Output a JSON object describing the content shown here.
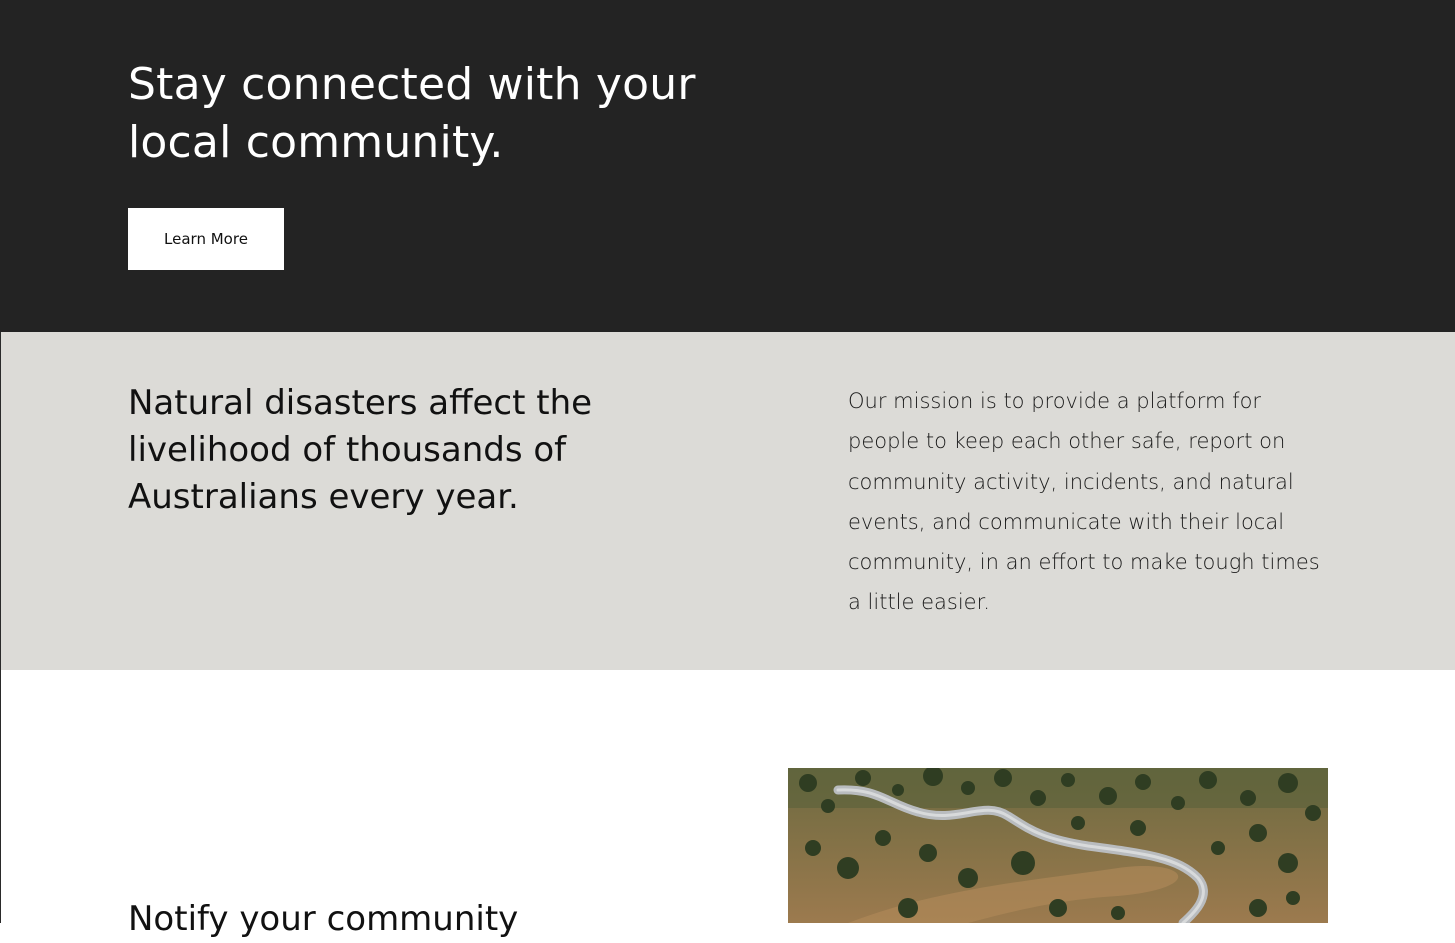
{
  "hero": {
    "title": "Stay connected with your local community.",
    "button_label": "Learn More"
  },
  "mission": {
    "heading": "Natural disasters affect the livelihood of thousands of Australians every year.",
    "body": "Our mission is to provide a platform for people to keep each other safe, report on community activity, incidents, and natural events, and communicate with their local community, in an effort to make tough times a little easier."
  },
  "notify": {
    "title": "Notify your community"
  },
  "colors": {
    "hero_bg": "#232323",
    "mission_bg": "#dcdbd7",
    "button_bg": "#ffffff"
  }
}
